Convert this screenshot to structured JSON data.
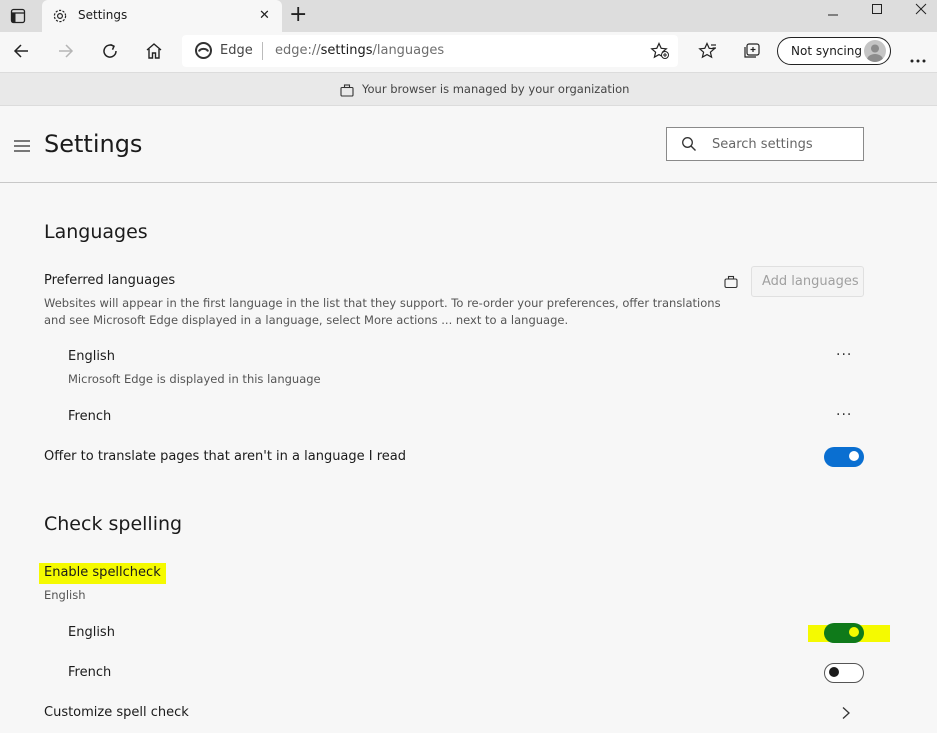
{
  "browser": {
    "tab_title": "Settings",
    "new_tab_glyph": "+",
    "close_glyph": "✕",
    "address_brand": "Edge",
    "address_url_prefix": "edge://",
    "address_url_main": "settings",
    "address_url_suffix": "/languages",
    "sync_label": "Not syncing",
    "managed_notice": "Your browser is managed by your organization",
    "window_controls": [
      "minimize-icon",
      "maximize-icon",
      "close-icon"
    ]
  },
  "settings": {
    "title": "Settings",
    "search_placeholder": "Search settings"
  },
  "languages": {
    "section_title": "Languages",
    "preferred_title": "Preferred languages",
    "preferred_desc": "Websites will appear in the first language in the list that they support. To re-order your preferences, offer translations and see Microsoft Edge displayed in a language, select More actions ... next to a language.",
    "add_button": "Add languages",
    "list": [
      {
        "name": "English",
        "note": "Microsoft Edge is displayed in this language"
      },
      {
        "name": "French",
        "note": ""
      }
    ],
    "more_glyph": "···",
    "translate_label": "Offer to translate pages that aren't in a language I read",
    "translate_on": true
  },
  "spelling": {
    "section_title": "Check spelling",
    "enable_label": "Enable spellcheck",
    "enable_sub": "English",
    "list": [
      {
        "name": "English",
        "on": true
      },
      {
        "name": "French",
        "on": false
      }
    ],
    "customize_label": "Customize spell check"
  },
  "colors": {
    "accent": "#0a6fd1",
    "highlight": "#f5fa00",
    "toggle_highlight": "#0f7a1a"
  }
}
